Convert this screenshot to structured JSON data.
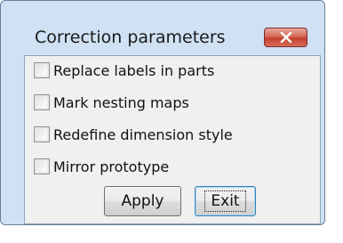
{
  "dialog": {
    "title": "Correction parameters",
    "close_icon": "close-icon",
    "options": [
      {
        "label": "Replace labels in parts",
        "checked": false
      },
      {
        "label": "Mark nesting maps",
        "checked": false
      },
      {
        "label": "Redefine dimension style",
        "checked": false
      },
      {
        "label": "Mirror prototype",
        "checked": false
      }
    ],
    "buttons": {
      "apply_label": "Apply",
      "exit_label": "Exit"
    }
  },
  "colors": {
    "frame": "#cfe1f3",
    "client": "#f0f0f0",
    "close_button": "#c4402c"
  }
}
